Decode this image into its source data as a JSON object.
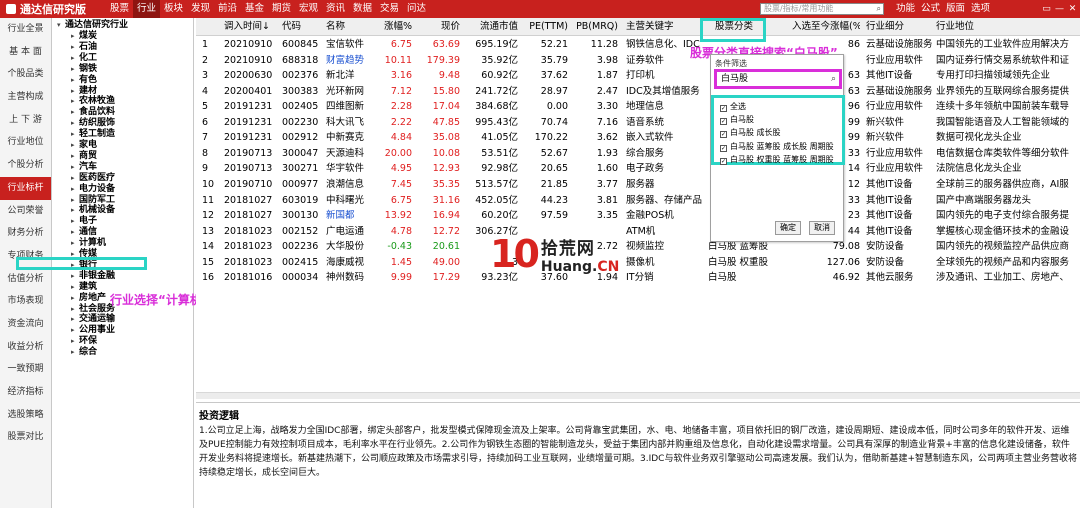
{
  "app": {
    "title": "通达信研究版"
  },
  "menu": [
    "股票",
    "行业",
    "板块",
    "发现",
    "前沿",
    "基金",
    "期货",
    "宏观",
    "资讯",
    "数据",
    "交易",
    "问达"
  ],
  "search": {
    "placeholder": "股票/指标/常用功能"
  },
  "right_menu": [
    "功能",
    "公式",
    "版面",
    "选项"
  ],
  "window_controls": [
    "▭",
    "—",
    "✕"
  ],
  "left_nav": [
    "行业全景",
    "基 本 面",
    "个股品类",
    "主营构成",
    "上 下 游",
    "行业地位",
    "个股分析",
    "行业标杆",
    "公司荣誉",
    "财务分析",
    "专项财务",
    "估值分析",
    "市场表现",
    "资金流向",
    "收益分析",
    "一致预期",
    "经济指标",
    "选股策略",
    "股票对比"
  ],
  "tree": {
    "root": "通达信研究行业",
    "items": [
      "煤炭",
      "石油",
      "化工",
      "钢铁",
      "有色",
      "建材",
      "农林牧渔",
      "食品饮料",
      "纺织服饰",
      "轻工制造",
      "家电",
      "商贸",
      "汽车",
      "医药医疗",
      "电力设备",
      "国防军工",
      "机械设备",
      "电子",
      "通信",
      "计算机",
      "传媒",
      "银行",
      "非银金融",
      "建筑",
      "房地产",
      "社会服务",
      "交通运输",
      "公用事业",
      "环保",
      "综合"
    ],
    "selected": "计算机"
  },
  "table": {
    "headers": [
      "",
      "调入时间↓",
      "代码",
      "名称",
      "涨幅%",
      "现价",
      "流通市值",
      "PE(TTM)",
      "PB(MRQ)",
      "主营关键字",
      "股票分类",
      "入选至今涨幅(%)",
      "行业细分",
      "行业地位"
    ],
    "rows": [
      [
        "1",
        "20210910",
        "600845",
        "宝信软件",
        "6.75",
        "63.69",
        "695.19亿",
        "52.21",
        "11.28",
        "钢铁信息化、IDC",
        "",
        "86",
        "云基础设施服务",
        "中国领先的工业软件应用解决方"
      ],
      [
        "2",
        "20210910",
        "688318",
        "财富趋势",
        "10.11",
        "179.39",
        "35.92亿",
        "35.79",
        "3.98",
        "证券软件",
        "",
        "",
        "行业应用软件",
        "国内证券行情交易系统软件和证"
      ],
      [
        "3",
        "20200630",
        "002376",
        "新北洋",
        "3.16",
        "9.48",
        "60.92亿",
        "37.62",
        "1.87",
        "打印机",
        "",
        "63",
        "其他IT设备",
        "专用打印扫描领域领先企业"
      ],
      [
        "4",
        "20200401",
        "300383",
        "光环新网",
        "7.12",
        "15.80",
        "241.72亿",
        "28.97",
        "2.47",
        "IDC及其增值服务",
        "",
        "63",
        "云基础设施服务",
        "业界领先的互联网综合服务提供"
      ],
      [
        "5",
        "20191231",
        "002405",
        "四维图新",
        "2.28",
        "17.04",
        "384.68亿",
        "0.00",
        "3.30",
        "地理信息",
        "",
        "96",
        "行业应用软件",
        "连续十多年领航中国前装车载导"
      ],
      [
        "6",
        "20191231",
        "002230",
        "科大讯飞",
        "2.22",
        "47.85",
        "995.43亿",
        "70.74",
        "7.16",
        "语音系统",
        "",
        "99",
        "新兴软件",
        "我国智能语音及人工智能领域的"
      ],
      [
        "7",
        "20191231",
        "002912",
        "中新赛克",
        "4.84",
        "35.08",
        "41.05亿",
        "170.22",
        "3.62",
        "嵌入式软件",
        "",
        "99",
        "新兴软件",
        "数据可视化龙头企业"
      ],
      [
        "8",
        "20190713",
        "300047",
        "天源迪科",
        "20.00",
        "10.08",
        "53.51亿",
        "52.67",
        "1.93",
        "综合服务",
        "",
        "33",
        "行业应用软件",
        "电信数据仓库类软件等细分软件"
      ],
      [
        "9",
        "20190713",
        "300271",
        "华宇软件",
        "4.95",
        "12.93",
        "92.98亿",
        "20.65",
        "1.60",
        "电子政务",
        "",
        "14",
        "行业应用软件",
        "法院信息化龙头企业"
      ],
      [
        "10",
        "20190710",
        "000977",
        "浪潮信息",
        "7.45",
        "35.35",
        "513.57亿",
        "21.85",
        "3.77",
        "服务器",
        "",
        "12",
        "其他IT设备",
        "全球前三的服务器供应商，AI服"
      ],
      [
        "11",
        "20181027",
        "603019",
        "中科曙光",
        "6.75",
        "31.16",
        "452.05亿",
        "44.23",
        "3.81",
        "服务器、存储产品",
        "",
        "33",
        "其他IT设备",
        "国产中高端服务器龙头"
      ],
      [
        "12",
        "20181027",
        "300130",
        "新国都",
        "13.92",
        "16.94",
        "60.20亿",
        "97.59",
        "3.35",
        "金融POS机",
        "",
        "23",
        "其他IT设备",
        "国内领先的电子支付综合服务提"
      ],
      [
        "13",
        "20181023",
        "002152",
        "广电运通",
        "4.78",
        "12.72",
        "306.27亿",
        "",
        "",
        "ATM机",
        "",
        "44",
        "其他IT设备",
        "掌握核心现金循环技术的金融设"
      ],
      [
        "14",
        "20181023",
        "002236",
        "大华股份",
        "-0.43",
        "20.61",
        "",
        "",
        "2.72",
        "视频监控",
        "白马股 蓝筹股",
        "79.08",
        "安防设备",
        "国内领先的视频监控产品供应商"
      ],
      [
        "15",
        "20181023",
        "002415",
        "海康威视",
        "1.45",
        "49.00",
        "3",
        "",
        "",
        "摄像机",
        "白马股 权重股",
        "127.06",
        "安防设备",
        "全球领先的视频产品和内容服务"
      ],
      [
        "16",
        "20181016",
        "000034",
        "神州数码",
        "9.99",
        "17.29",
        "93.23亿",
        "37.60",
        "1.94",
        "IT分销",
        "白马股",
        "46.92",
        "其他云服务",
        "涉及通讯、工业加工、房地产、"
      ]
    ]
  },
  "popup": {
    "title": "条件筛选",
    "search_value": "白马股",
    "options": [
      "全选",
      "白马股",
      "白马股 成长股",
      "白马股 蓝筹股 成长股 周期股",
      "白马股 权重股 蓝筹股 周期股"
    ],
    "ok_label": "确定",
    "cancel_label": "取消"
  },
  "annotations": {
    "tree_note": "行业选择“计算机”",
    "popup_note": "股票分类直接搜索“白马股”"
  },
  "watermark": {
    "num": "10",
    "cn": "拾荒网",
    "en_prefix": "Huang.",
    "en_suffix": "CN"
  },
  "logic": {
    "title": "投资逻辑",
    "text": "1.公司立足上海，战略发力全国IDC部署，绑定头部客户，批发型模式保障现金流及上架率。公司背靠宝武集团，水、电、地储备丰富，项目依托旧的钢厂改造，建设周期短、建设成本低，同时公司多年的软件开发、运维及PUE控制能力有效控制项目成本，毛利率水平在行业领先。2.公司作为钢铁生态圈的智能制造龙头，受益于集团内部并购重组及信息化，自动化建设需求增量。公司具有深厚的制造业背景+丰富的信息化建设储备，软件开发业务料将提速增长。新基建热潮下，公司顺应政策及市场需求引导，持续加码工业互联网，业绩增量可期。3.IDC与软件业务双引擎驱动公司高速发展。我们认为，借助新基建+智慧制造东风，公司两项主营业务营收将持续稳定增长，成长空间巨大。"
  },
  "colors": {
    "brand_red": "#c8211e",
    "highlight_cyan": "#2ad4c5",
    "highlight_magenta": "#d92ed9",
    "up_red": "#e02020",
    "down_green": "#1a9a1a"
  }
}
